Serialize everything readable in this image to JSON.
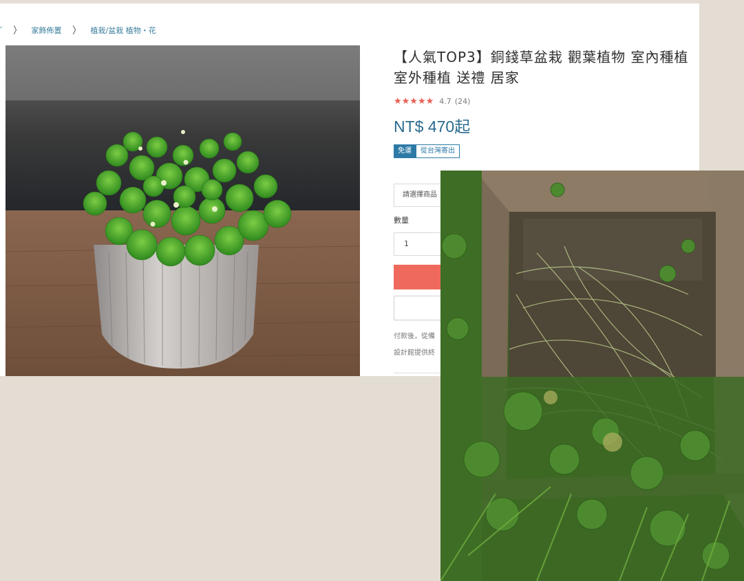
{
  "breadcrumb": {
    "cut_glyph": "ﾞ",
    "items": [
      "家飾佈置",
      "植栽/盆栽 植物・花"
    ],
    "separator": "〉"
  },
  "product": {
    "title": "【人氣TOP3】銅錢草盆栽 觀葉植物 室內種植 室外種植 送禮 居家",
    "stars": "★★★★★",
    "rating": "4.7",
    "review_count": "(24)",
    "price": "NT$ 470起",
    "tag_free": "免運",
    "tag_origin": "從台灣寄出",
    "select_placeholder": "請選擇商品",
    "quantity_label": "數量",
    "quantity_value": "1",
    "note_line1": "付款後，從備",
    "note_line2": "設計館提供終"
  },
  "colors": {
    "accent_blue": "#2d7aa7",
    "buy_red": "#ef6a5c",
    "star_red": "#ec5e52",
    "background": "#e3ddd3"
  },
  "images": {
    "hero": "potted-pennywort-plant-photo",
    "overlay": "pennywort-in-wooden-planter-photo"
  }
}
